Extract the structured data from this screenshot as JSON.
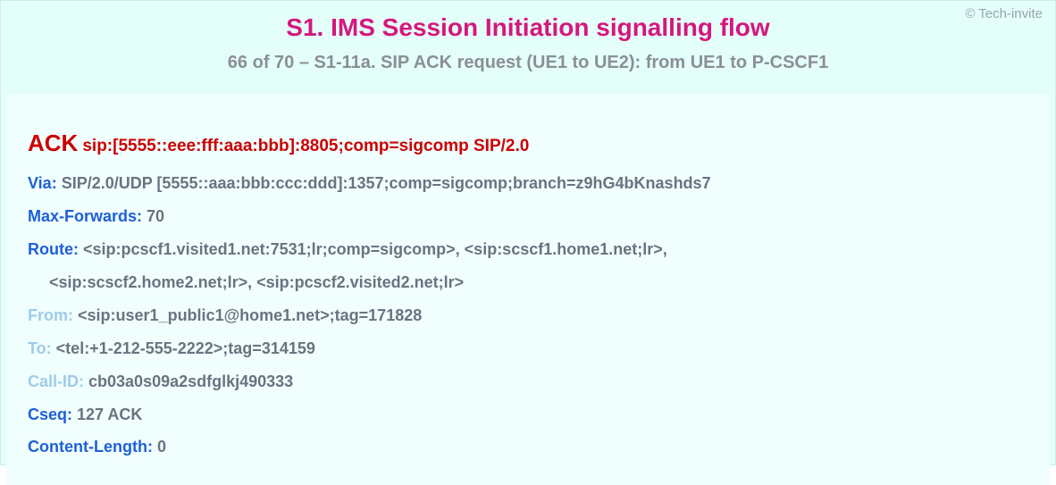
{
  "copyright": "© Tech-invite",
  "header": {
    "title": "S1. IMS Session Initiation signalling flow",
    "subtitle": "66 of 70 – S1-11a. SIP ACK request (UE1 to UE2): from UE1 to P-CSCF1"
  },
  "request": {
    "method": "ACK",
    "uri": "sip:[5555::eee:fff:aaa:bbb]:8805;comp=sigcomp SIP/2.0"
  },
  "headers": {
    "via": {
      "label": "Via:",
      "value": "SIP/2.0/UDP [5555::aaa:bbb:ccc:ddd]:1357;comp=sigcomp;branch=z9hG4bKnashds7"
    },
    "maxfwd": {
      "label": "Max-Forwards:",
      "value": "70"
    },
    "route": {
      "label": "Route:",
      "value1": "<sip:pcscf1.visited1.net:7531;lr;comp=sigcomp>, <sip:scscf1.home1.net;lr>,",
      "value2": "<sip:scscf2.home2.net;lr>, <sip:pcscf2.visited2.net;lr>"
    },
    "from": {
      "label": "From:",
      "value": "<sip:user1_public1@home1.net>;tag=171828"
    },
    "to": {
      "label": "To:",
      "value": "<tel:+1-212-555-2222>;tag=314159"
    },
    "callid": {
      "label": "Call-ID:",
      "value": "cb03a0s09a2sdfglkj490333"
    },
    "cseq": {
      "label": "Cseq:",
      "value": "127 ACK"
    },
    "contentlen": {
      "label": "Content-Length:",
      "value": "0"
    }
  }
}
